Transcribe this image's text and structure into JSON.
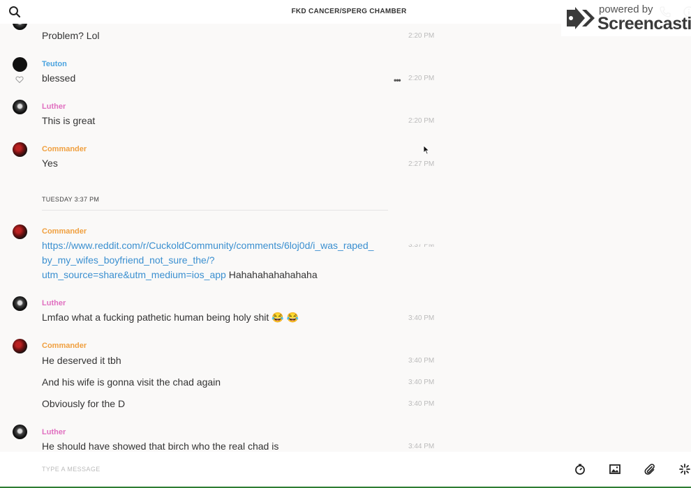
{
  "header": {
    "title": "FKD CANCER/SPERG CHAMBER"
  },
  "watermark": {
    "small": "powered by",
    "big": "Screencastify"
  },
  "messages": [
    {
      "text": "Problem? Lol",
      "time": "2:20 PM"
    },
    {
      "sender": "Teuton",
      "text": "blessed",
      "time": "2:20 PM"
    },
    {
      "sender": "Luther",
      "text": "This is great",
      "time": "2:20 PM"
    },
    {
      "sender": "Commander",
      "text": "Yes",
      "time": "2:27 PM"
    }
  ],
  "date_divider": "TUESDAY 3:37 PM",
  "messages_after": [
    {
      "sender": "Commander",
      "link_lines": [
        "https://www.reddit.com/r/CuckoldCommunity/comments/6loj0d/i_was_raped_",
        "by_my_wifes_boyfriend_not_sure_the/?",
        "utm_source=share&utm_medium=ios_app"
      ],
      "text": "Hahahahahahahaha",
      "time": "3:37 PM"
    },
    {
      "sender": "Luther",
      "text": "Lmfao what a fucking pathetic human being holy shit 😂 😂",
      "time": "3:40 PM"
    },
    {
      "sender": "Commander",
      "text": "He deserved it tbh",
      "time": "3:40 PM"
    },
    {
      "text": "And his wife is gonna visit the chad again",
      "time": "3:40 PM"
    },
    {
      "text": "Obviously for the D",
      "time": "3:40 PM"
    },
    {
      "sender": "Luther",
      "text": "He should have showed that birch who the real chad is",
      "time": "3:44 PM"
    }
  ],
  "composer": {
    "placeholder": "TYPE A MESSAGE"
  },
  "icons": {
    "header": [
      "search-icon",
      "phone-icon",
      "info-icon"
    ],
    "composer": [
      "timer-icon",
      "image-icon",
      "paperclip-icon",
      "sparkle-icon"
    ],
    "message": [
      "heart-icon",
      "more-icon"
    ]
  },
  "colors": {
    "teuton": "#4aa3df",
    "luther": "#e070c0",
    "commander": "#f0a040",
    "link": "#3a8fd0",
    "timestamp": "#bbbbbb"
  }
}
